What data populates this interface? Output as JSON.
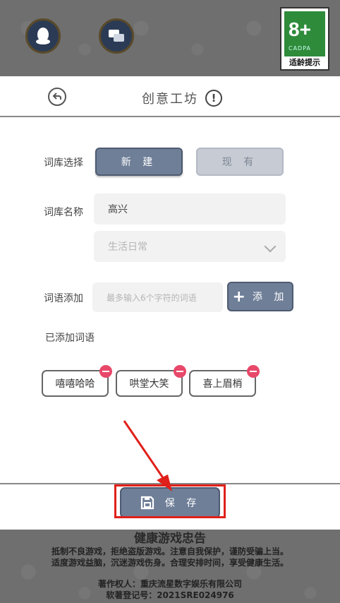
{
  "top": {
    "rating": {
      "age": "8+",
      "org": "CADPA",
      "hint": "适龄提示"
    }
  },
  "header": {
    "title": "创意工坊",
    "info": "!"
  },
  "form": {
    "library_select_label": "词库选择",
    "mode_new": "新 建",
    "mode_existing": "现 有",
    "library_name_label": "词库名称",
    "library_name_value": "高兴",
    "category_value": "生活日常",
    "word_add_label": "词语添加",
    "word_input_placeholder": "最多输入6个字符的词语",
    "add_button": "添 加",
    "added_words_label": "已添加词语",
    "added_words": [
      "嘻嘻哈哈",
      "哄堂大笑",
      "喜上眉梢"
    ]
  },
  "footer": {
    "save_button": "保 存"
  },
  "notice": {
    "title": "健康游戏忠告",
    "line1": "抵制不良游戏，拒绝盗版游戏。注意自我保护，谨防受骗上当。",
    "line2": "适度游戏益脑，沉迷游戏伤身。合理安排时间，享受健康生活。",
    "copyright": "著作权人：重庆流星数字娱乐有限公司",
    "registration": "软著登记号：2021SRE024976"
  },
  "colors": {
    "accent": "#6f7f98",
    "remove": "#e8486a",
    "highlight": "#e0201a"
  }
}
